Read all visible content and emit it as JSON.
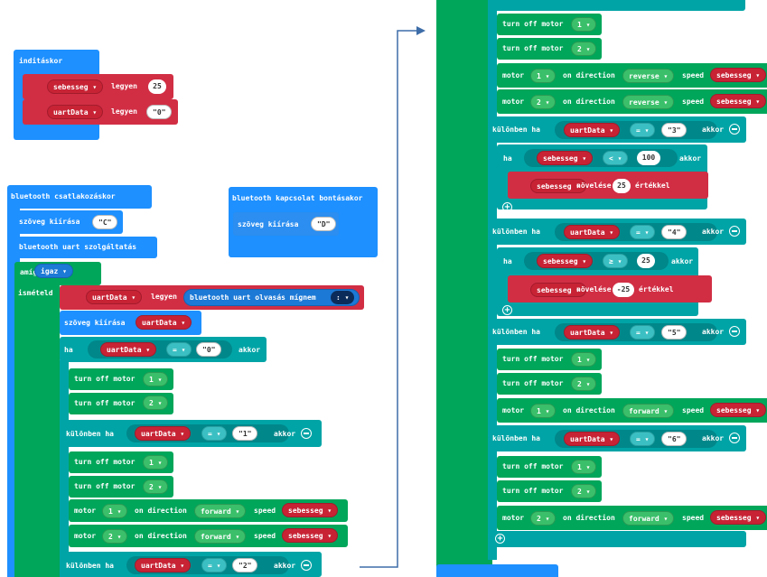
{
  "start_block": {
    "title": "inditáskor",
    "set1_var": "sebesseg",
    "set1_label": "legyen",
    "set1_value": "25",
    "set2_var": "uartData",
    "set2_label": "legyen",
    "set2_value": "\"0\""
  },
  "bt_connect": {
    "title": "bluetooth csatlakozáskor",
    "show_label": "szöveg kiírása",
    "show_value": "\"C\"",
    "service": "bluetooth uart szolgáltatás",
    "while_label": "amíg",
    "while_value": "igaz",
    "do_label": "ismételd",
    "set_var": "uartData",
    "set_label": "legyen",
    "read_label": "bluetooth uart olvasás mígnem",
    "read_delim": ":",
    "show2_label": "szöveg kiírása",
    "show2_var": "uartData"
  },
  "bt_disconnect": {
    "title": "bluetooth kapcsolat bontásakor",
    "show_label": "szöveg kiírása",
    "show_value": "\"D\""
  },
  "labels": {
    "if": "ha",
    "then": "akkor",
    "elseif": "különben ha",
    "eq": "=",
    "lt": "<",
    "ge": "≥",
    "turn_off": "turn off motor",
    "motor": "motor",
    "on_direction": "on direction",
    "speed": "speed",
    "forward": "forward",
    "reverse": "reverse",
    "sebesseg": "sebesseg",
    "uartData": "uartData",
    "increase": "növelése",
    "by": "értékkel",
    "m1": "1",
    "m2": "2"
  },
  "values": {
    "v0": "\"0\"",
    "v1": "\"1\"",
    "v2": "\"2\"",
    "v3": "\"3\"",
    "v4": "\"4\"",
    "v5": "\"5\"",
    "v6": "\"6\"",
    "n100": "100",
    "n25": "25",
    "nm25": "-25"
  }
}
